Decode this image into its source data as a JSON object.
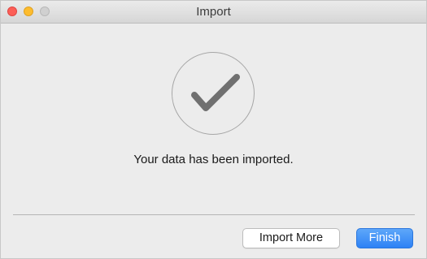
{
  "window": {
    "title": "Import"
  },
  "content": {
    "status_icon": "checkmark-icon",
    "message": "Your data has been imported."
  },
  "buttons": {
    "import_more_label": "Import More",
    "finish_label": "Finish"
  },
  "colors": {
    "close": "#fc5f57",
    "minimize": "#fdbc2e",
    "zoom": "#d0d0d0",
    "primary_button": "#2e82f5",
    "checkmark": "#707070"
  }
}
